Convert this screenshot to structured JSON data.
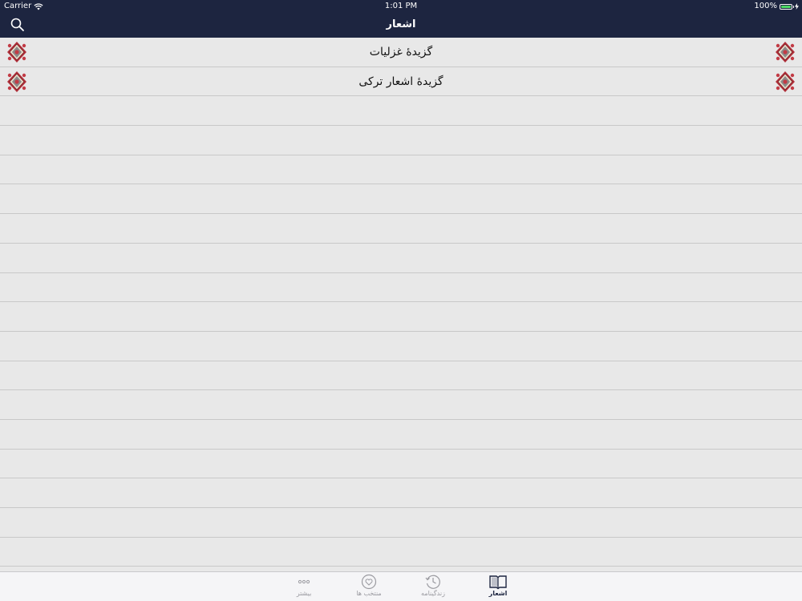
{
  "status_bar": {
    "carrier": "Carrier",
    "time": "1:01 PM",
    "battery": "100%"
  },
  "nav": {
    "title": "اشعار",
    "search_icon": "search-icon"
  },
  "list": {
    "items": [
      {
        "label": "گزیدهٔ غزلیات"
      },
      {
        "label": "گزیدهٔ اشعار ترکی"
      }
    ]
  },
  "tabbar": {
    "tabs": [
      {
        "label": "بیشتر",
        "icon": "more-icon"
      },
      {
        "label": "منتخب ها",
        "icon": "heart-icon"
      },
      {
        "label": "زندگینامه",
        "icon": "history-clock-icon"
      },
      {
        "label": "اشعار",
        "icon": "book-icon",
        "active": true
      }
    ]
  },
  "colors": {
    "nav_bg": "#1d2540",
    "list_bg": "#e8e8e8",
    "separator": "#c8c8c8",
    "battery": "#4cd964",
    "tab_active": "#1d2540",
    "tab_inactive": "#9a9aa0"
  }
}
